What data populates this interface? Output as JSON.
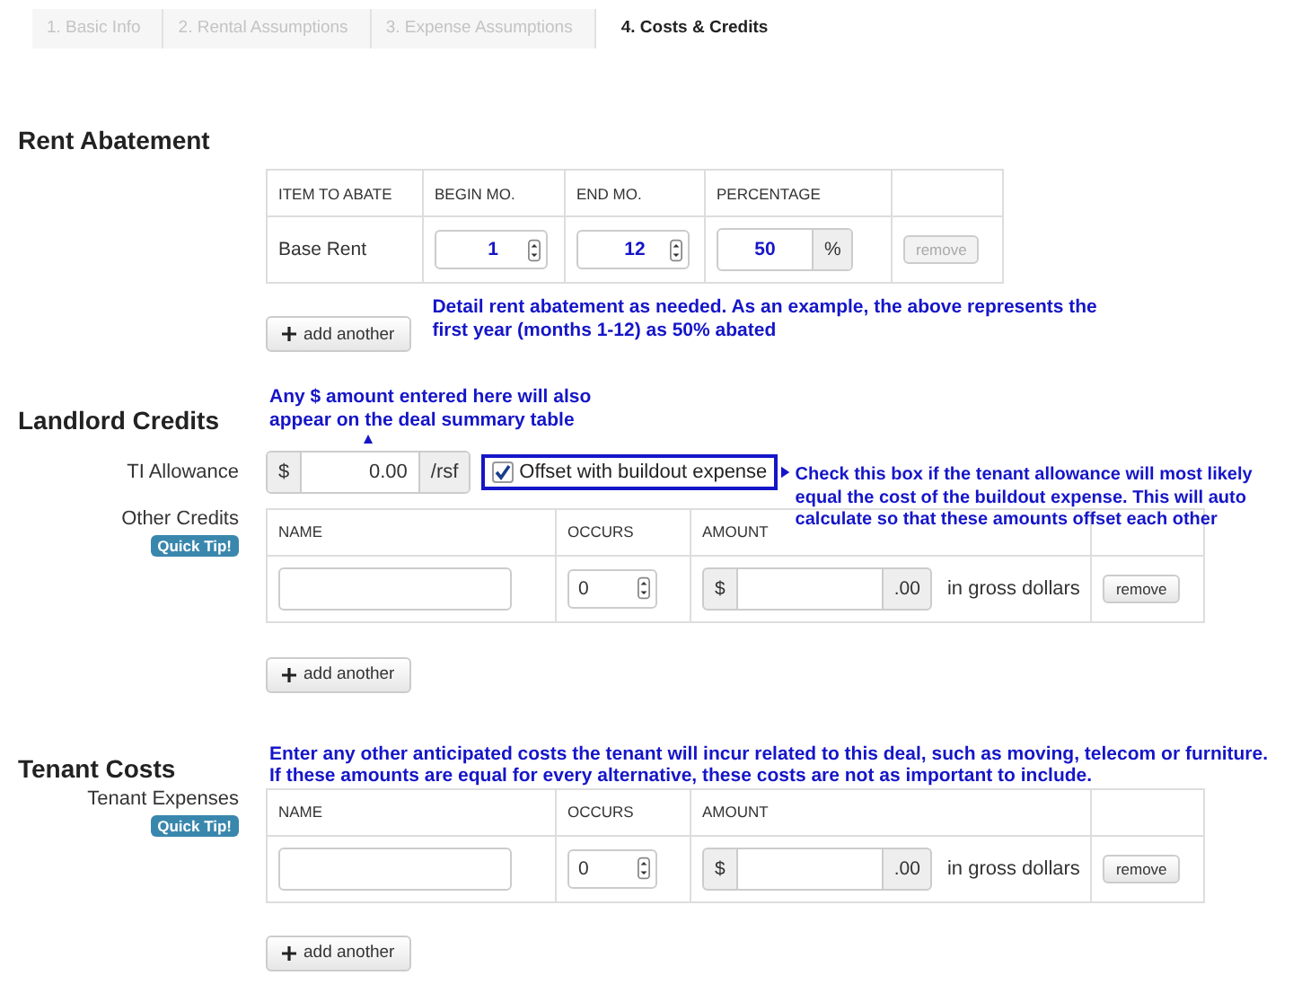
{
  "steps": [
    {
      "label": "1. Basic Info",
      "selected": false
    },
    {
      "label": "2. Rental Assumptions",
      "selected": false
    },
    {
      "label": "3. Expense Assumptions",
      "selected": false
    },
    {
      "label": "4. Costs & Credits",
      "selected": true
    }
  ],
  "sections": [
    {
      "kind": "abatement",
      "title": "Rent Abatement",
      "columns": [
        "ITEM TO ABATE",
        "BEGIN MO.",
        "END MO.",
        "PERCENTAGE"
      ],
      "rows": [
        {
          "item": "Base Rent",
          "begin": "1",
          "end": "12",
          "percentage": "50",
          "unit": "%",
          "remove": "remove",
          "disabled": true
        }
      ],
      "add_button": "add another",
      "note": "Detail rent abatement as needed. As an example, the above represents the first year (months 1-12) as 50% abated"
    },
    {
      "kind": "credits",
      "title": "Landlord Credits",
      "note": "Any $ amount entered here will also appear on the deal summary table",
      "ti": {
        "label": "TI Allowance",
        "prefix": "$",
        "value": "0.00",
        "suffix": "/rsf",
        "checkbox": {
          "label": "Offset with buildout expense",
          "checked": true
        },
        "note": "Check this box if the tenant allowance will most likely equal the cost of the buildout expense. This will auto calculate so that these amounts offset each other"
      },
      "field": {
        "label": "Other Credits",
        "tip": "Quick Tip!",
        "columns": [
          "NAME",
          "OCCURS",
          "AMOUNT"
        ],
        "rows": [
          {
            "occurs": "0",
            "prefix": "$",
            "suffix": ".00",
            "unit": "in gross dollars",
            "remove": "remove",
            "disabled": false
          }
        ]
      },
      "add_button": "add another"
    },
    {
      "kind": "costs",
      "title": "Tenant Costs",
      "note": "Enter any other anticipated costs the tenant will incur related to this deal, such as moving, telecom or furniture. If these amounts are equal for every alternative, these costs are not as important to include.",
      "field": {
        "label": "Tenant Expenses",
        "tip": "Quick Tip!",
        "columns": [
          "NAME",
          "OCCURS",
          "AMOUNT"
        ],
        "rows": [
          {
            "occurs": "0",
            "prefix": "$",
            "suffix": ".00",
            "unit": "in gross dollars",
            "remove": "remove",
            "disabled": false
          }
        ]
      },
      "add_button": "add another"
    }
  ]
}
